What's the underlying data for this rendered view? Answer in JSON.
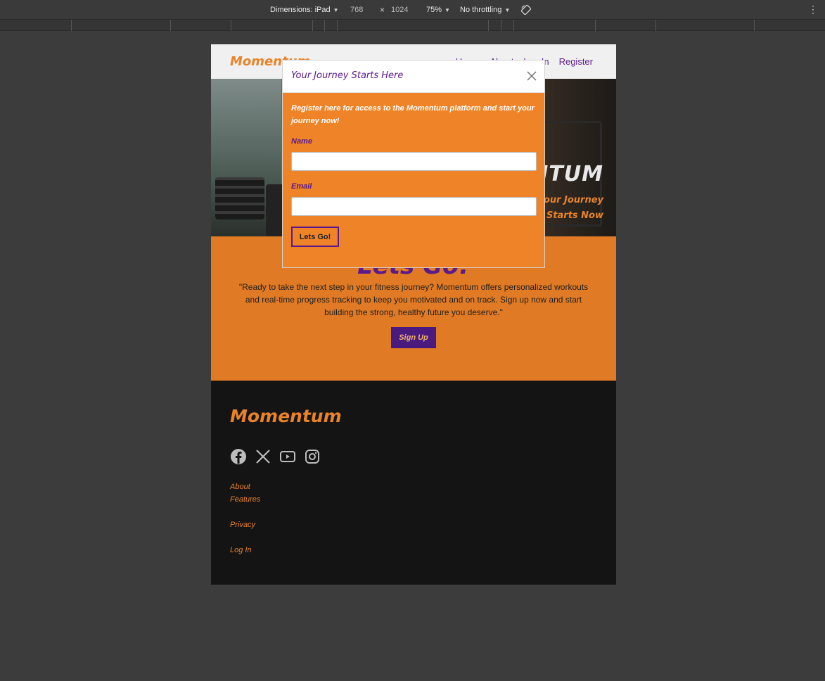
{
  "devtools": {
    "dimensions_label": "Dimensions: iPad",
    "width": "768",
    "times": "×",
    "height": "1024",
    "zoom": "75%",
    "throttling": "No throttling"
  },
  "nav": {
    "logo": "Momentum",
    "links": [
      "Home",
      "About",
      "Log In",
      "Register"
    ]
  },
  "hero": {
    "brand": "MOMENTUM",
    "tagline_line1": "Your Journey",
    "tagline_line2": "Starts Now"
  },
  "cta": {
    "heading": "Lets Go!",
    "quote": "\"Ready to take the next step in your fitness journey? Momentum offers personalized workouts and real-time progress tracking to keep you motivated and on track. Sign up now and start building the strong, healthy future you deserve.\"",
    "button": "Sign Up"
  },
  "footer": {
    "logo": "Momentum",
    "socials": [
      "facebook-icon",
      "x-icon",
      "youtube-icon",
      "instagram-icon"
    ],
    "links": [
      "About",
      "Features",
      "Privacy",
      "Log In"
    ]
  },
  "modal": {
    "title": "Your Journey Starts Here",
    "intro": "Register here for access to the Momentum platform and start your journey now!",
    "name_label": "Name",
    "email_label": "Email",
    "submit": "Lets Go!"
  },
  "colors": {
    "brand_orange": "#e8832a",
    "brand_purple": "#5a1a8c"
  }
}
